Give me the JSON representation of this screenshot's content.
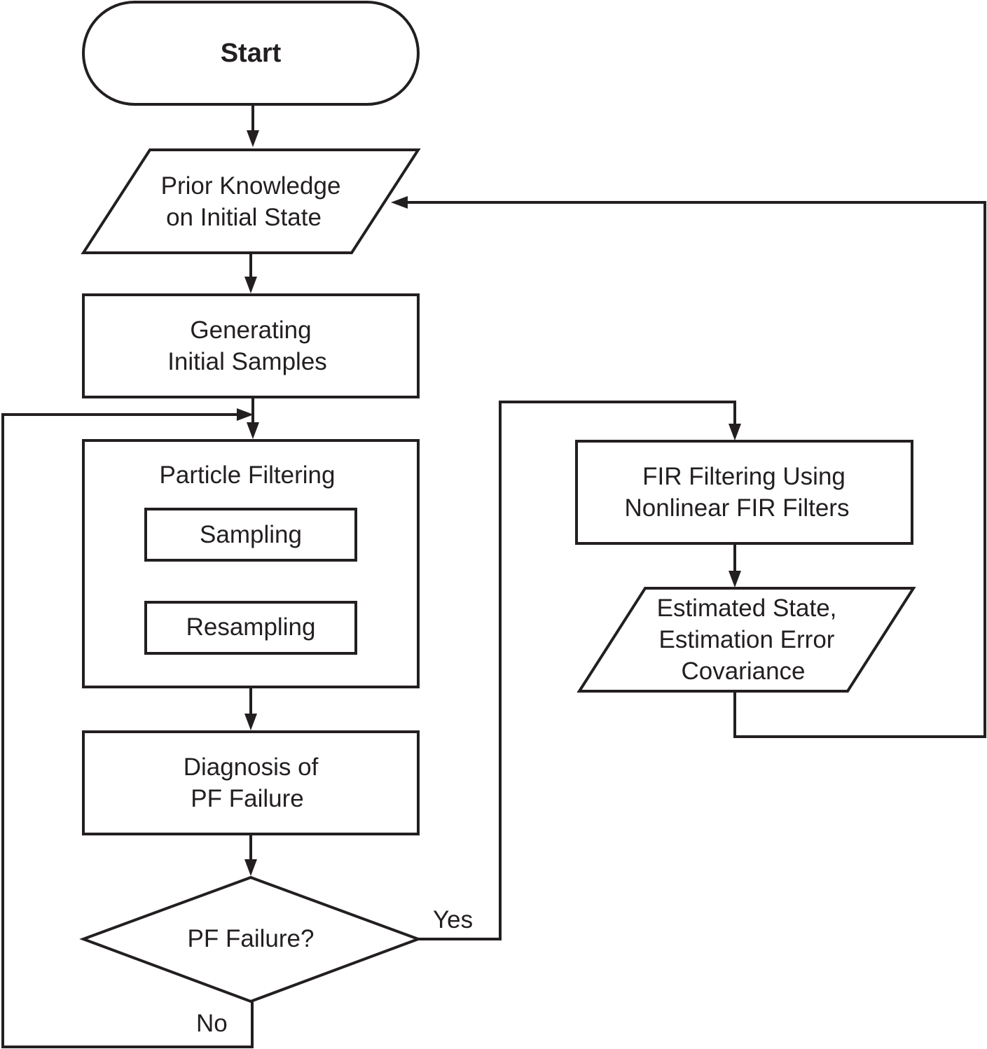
{
  "nodes": {
    "start": {
      "type": "terminal",
      "lines": [
        "Start"
      ]
    },
    "prior_knowledge": {
      "type": "io",
      "lines": [
        "Prior Knowledge",
        "on Initial State"
      ]
    },
    "generating_samples": {
      "type": "process",
      "lines": [
        "Generating",
        "Initial Samples"
      ]
    },
    "particle_filtering": {
      "type": "process",
      "lines": [
        "Particle Filtering"
      ]
    },
    "sampling": {
      "type": "process",
      "lines": [
        "Sampling"
      ]
    },
    "resampling": {
      "type": "process",
      "lines": [
        "Resampling"
      ]
    },
    "diagnosis": {
      "type": "process",
      "lines": [
        "Diagnosis of",
        "PF Failure"
      ]
    },
    "pf_failure": {
      "type": "decision",
      "lines": [
        "PF Failure?"
      ]
    },
    "fir_filtering": {
      "type": "process",
      "lines": [
        "FIR Filtering Using",
        "Nonlinear FIR Filters"
      ]
    },
    "estimated_state": {
      "type": "io",
      "lines": [
        "Estimated State,",
        "Estimation Error",
        "Covariance"
      ]
    }
  },
  "edges": [
    {
      "from": "start",
      "to": "prior_knowledge",
      "label": ""
    },
    {
      "from": "prior_knowledge",
      "to": "generating_samples",
      "label": ""
    },
    {
      "from": "generating_samples",
      "to": "particle_filtering",
      "label": ""
    },
    {
      "from": "sampling",
      "to": "resampling",
      "label": ""
    },
    {
      "from": "particle_filtering",
      "to": "diagnosis",
      "label": ""
    },
    {
      "from": "diagnosis",
      "to": "pf_failure",
      "label": ""
    },
    {
      "from": "pf_failure",
      "to": "fir_filtering",
      "label": "Yes"
    },
    {
      "from": "pf_failure",
      "to": "particle_filtering",
      "label": "No"
    },
    {
      "from": "fir_filtering",
      "to": "estimated_state",
      "label": ""
    },
    {
      "from": "estimated_state",
      "to": "prior_knowledge",
      "label": ""
    }
  ],
  "labels": {
    "yes": "Yes",
    "no": "No"
  }
}
